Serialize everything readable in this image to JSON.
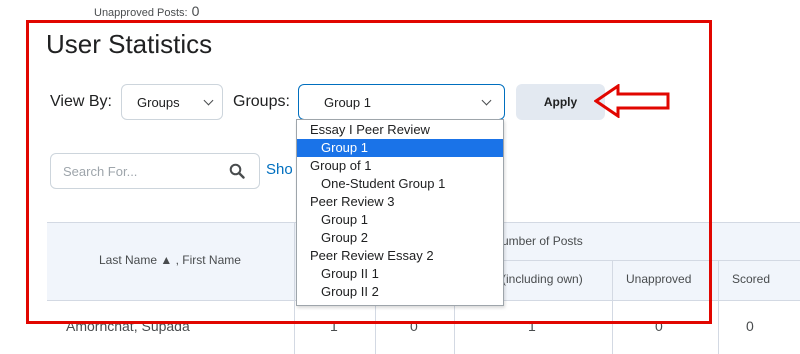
{
  "header": {
    "unapproved_posts_label": "Unapproved Posts:",
    "unapproved_posts_value": "0"
  },
  "page_title": "User Statistics",
  "filters": {
    "view_by_label": "View By:",
    "view_by_value": "Groups",
    "groups_label": "Groups:",
    "groups_value": "Group 1",
    "apply_label": "Apply"
  },
  "search": {
    "placeholder": "Search For...",
    "show_link_partial": "Sho"
  },
  "groups_dropdown": {
    "options": [
      {
        "label": "Essay I Peer Review",
        "kind": "category"
      },
      {
        "label": "Group 1",
        "kind": "group",
        "selected": true
      },
      {
        "label": "Group of 1",
        "kind": "category"
      },
      {
        "label": "One-Student Group 1",
        "kind": "group"
      },
      {
        "label": "Peer Review 3",
        "kind": "category"
      },
      {
        "label": "Group 1",
        "kind": "group"
      },
      {
        "label": "Group 2",
        "kind": "group"
      },
      {
        "label": "Peer Review Essay 2",
        "kind": "category"
      },
      {
        "label": "Group II 1",
        "kind": "group"
      },
      {
        "label": "Group II 2",
        "kind": "group"
      }
    ]
  },
  "table": {
    "name_header": "Last Name ▲ , First Name",
    "posts_header_partial": "umber of Posts",
    "sub_headers": {
      "including_own_partial": "(including own)",
      "unapproved": "Unapproved",
      "scored": "Scored"
    },
    "rows": [
      {
        "name": "Amornchat, Supada",
        "col1": "1",
        "col2": "0",
        "col3": "1",
        "unapproved": "0",
        "scored": "0"
      }
    ]
  },
  "annotation": {
    "highlight_color": "#e10600"
  }
}
